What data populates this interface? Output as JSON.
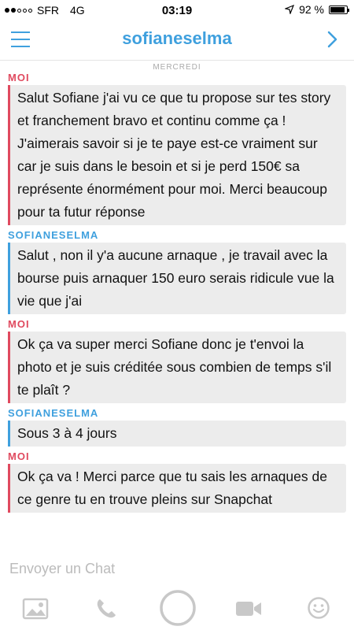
{
  "status_bar": {
    "carrier": "SFR",
    "network": "4G",
    "time": "03:19",
    "battery": "92 %",
    "battery_level": 0.92,
    "signal_filled": 2,
    "signal_total": 5
  },
  "header": {
    "title": "sofianeselma"
  },
  "day_label": "MERCREDI",
  "messages": [
    {
      "sender": "MOI",
      "from_me": true,
      "text": "Salut Sofiane j'ai vu ce que tu propose sur tes story et franchement bravo et continu comme ça ! J'aimerais savoir si je te paye est-ce vraiment sur car je suis dans le besoin et si je perd 150€ sa représente énormément pour moi. Merci beaucoup pour ta futur réponse"
    },
    {
      "sender": "SOFIANESELMA",
      "from_me": false,
      "text": "Salut , non il y'a aucune arnaque , je travail avec la bourse puis arnaquer 150 euro serais ridicule vue la vie que j'ai"
    },
    {
      "sender": "MOI",
      "from_me": true,
      "text": "Ok ça va super merci Sofiane donc je t'envoi la photo et je suis créditée sous combien de temps s'il te plaît ?"
    },
    {
      "sender": "SOFIANESELMA",
      "from_me": false,
      "text": "Sous 3 à 4 jours"
    },
    {
      "sender": "MOI",
      "from_me": true,
      "text": "Ok  ça va ! Merci parce que tu sais les arnaques de ce genre tu en trouve pleins sur Snapchat"
    }
  ],
  "composer": {
    "placeholder": "Envoyer un Chat"
  },
  "toolbar": {
    "icons": [
      "image-icon",
      "phone-icon",
      "capture-button",
      "video-icon",
      "emoji-icon"
    ]
  },
  "colors": {
    "accent_blue": "#3fa0de",
    "me_red": "#e04a5f",
    "bubble_bg": "#ececec"
  }
}
